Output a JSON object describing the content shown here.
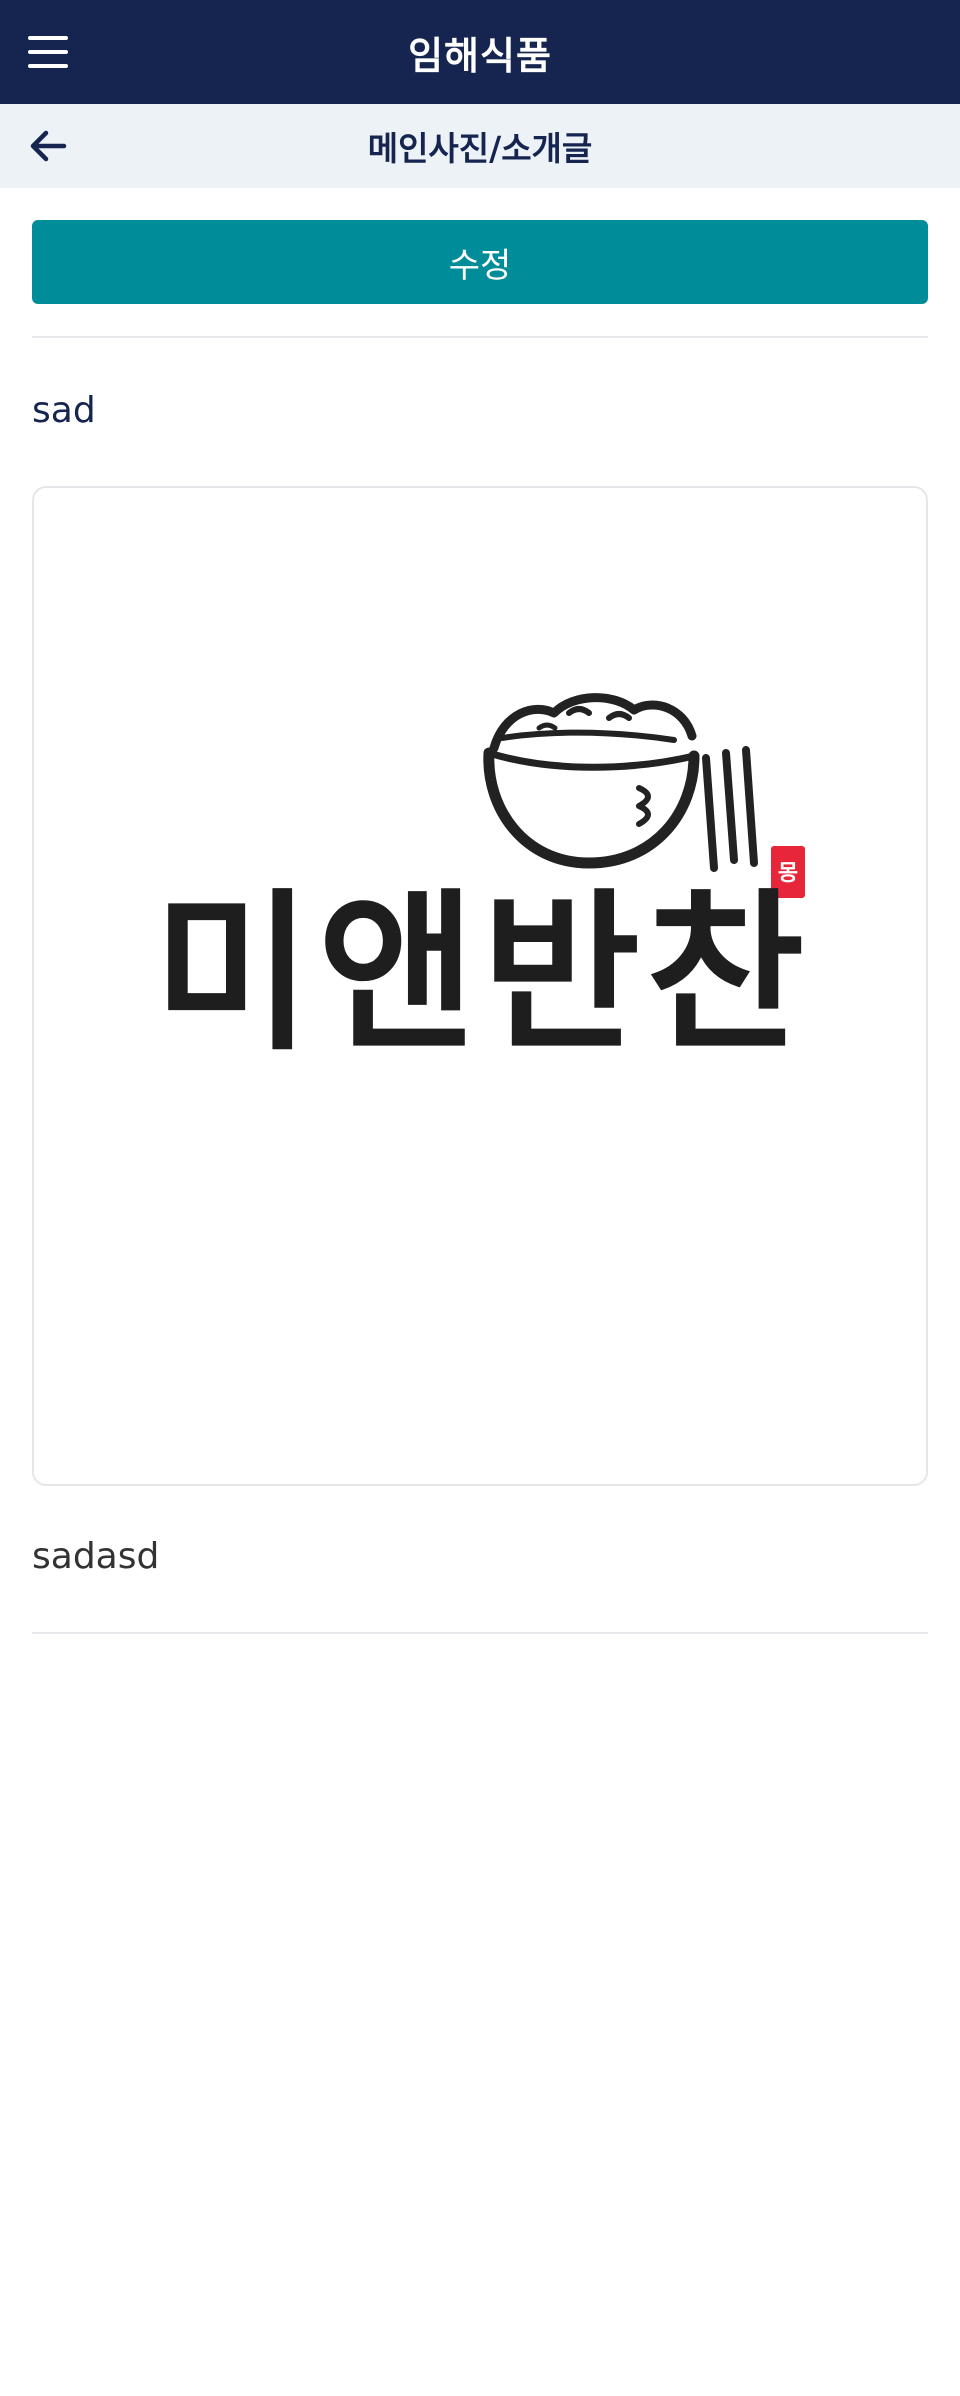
{
  "header": {
    "app_title": "임해식품",
    "menu_icon": "hamburger-menu-icon"
  },
  "subheader": {
    "back_icon": "arrow-left-icon",
    "page_title": "메인사진/소개글"
  },
  "actions": {
    "edit_label": "수정"
  },
  "content": {
    "title": "sad",
    "image": {
      "description_icon": "brand-logo-image",
      "logo_text": "미앤반찬"
    },
    "body": "sadasd"
  },
  "colors": {
    "header_bg": "#16254f",
    "subheader_bg": "#edf2f7",
    "accent": "#008c99",
    "logo_stamp": "#e8263a"
  }
}
